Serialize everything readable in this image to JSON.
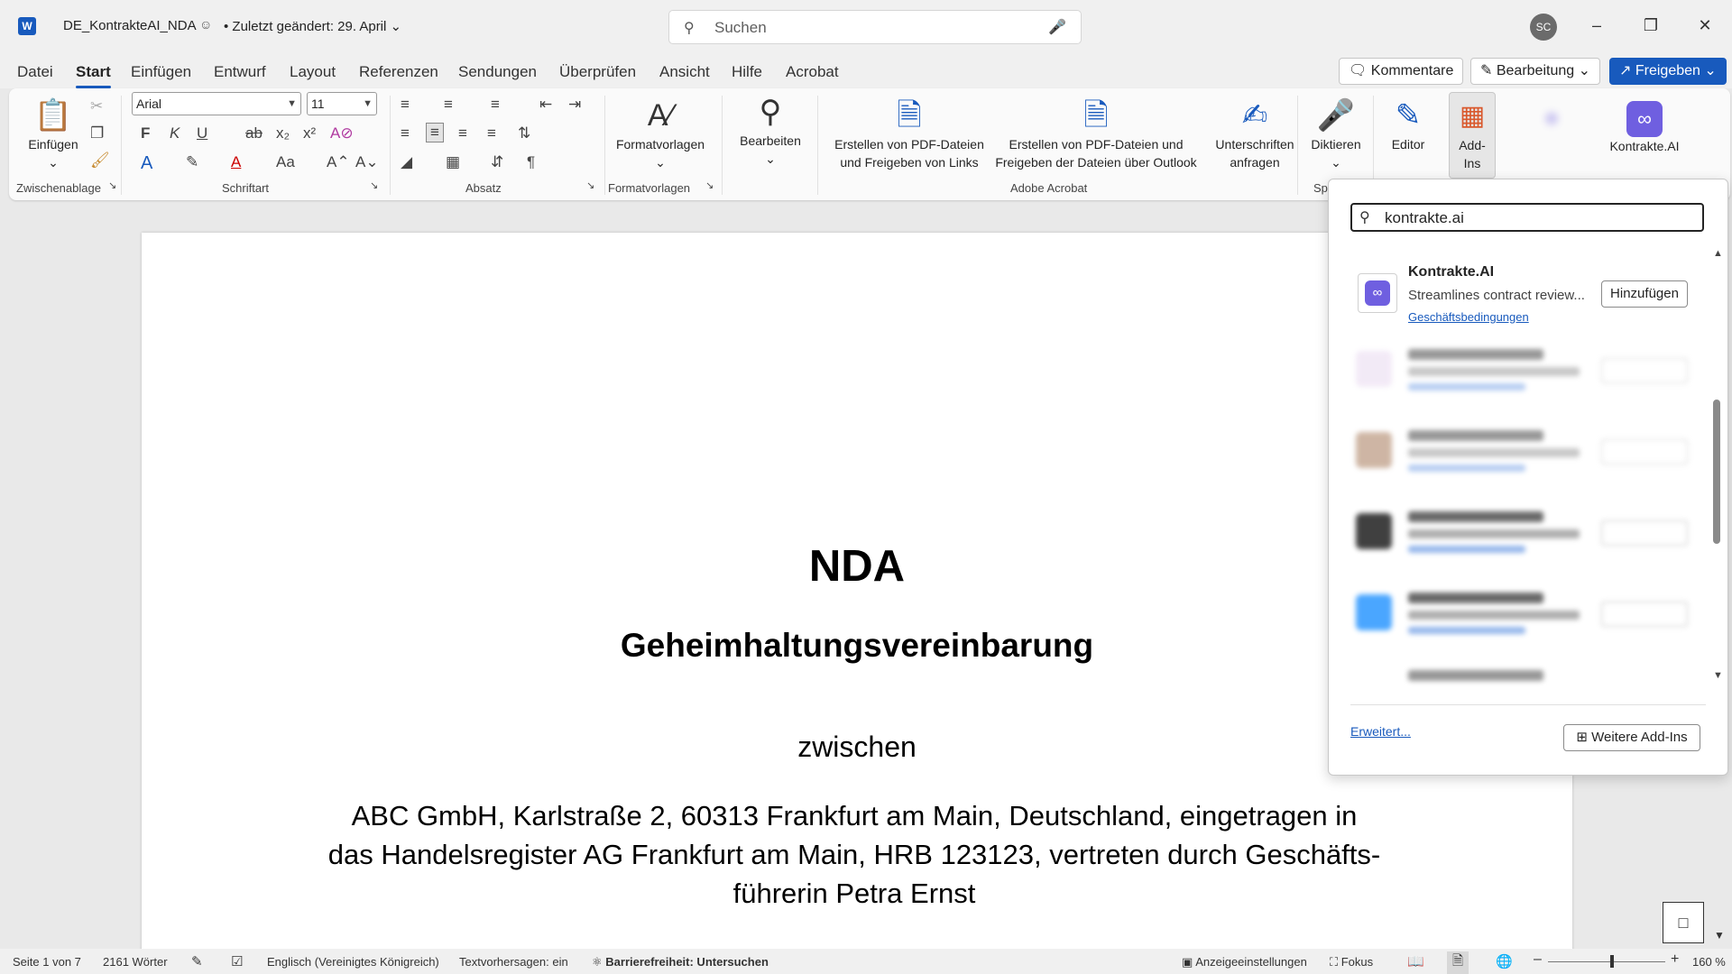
{
  "titlebar": {
    "app_icon": "word-icon",
    "app_letter": "W",
    "doc_name": "DE_KontrakteAI_NDA",
    "modified": "• Zuletzt geändert: 29. April",
    "search_placeholder": "Suchen",
    "avatar_initials": "SC"
  },
  "menu": {
    "tabs": [
      "Datei",
      "Start",
      "Einfügen",
      "Entwurf",
      "Layout",
      "Referenzen",
      "Sendungen",
      "Überprüfen",
      "Ansicht",
      "Hilfe",
      "Acrobat"
    ],
    "active": "Start",
    "comments": "Kommentare",
    "editing": "Bearbeitung",
    "share": "Freigeben"
  },
  "ribbon": {
    "paste": "Einfügen",
    "font_name": "Arial",
    "font_size": "11",
    "groups": {
      "clipboard": "Zwischenablage",
      "font": "Schriftart",
      "paragraph": "Absatz",
      "styles": "Formatvorlagen",
      "acrobat": "Adobe Acrobat",
      "voice": "Sp"
    },
    "styles_btn": "Formatvorlagen",
    "edit_btn": "Bearbeiten",
    "pdf_links_line1": "Erstellen von PDF-Dateien",
    "pdf_links_line2": "und Freigeben von Links",
    "pdf_outlook_line1": "Erstellen von PDF-Dateien und",
    "pdf_outlook_line2": "Freigeben der Dateien über Outlook",
    "signatures_line1": "Unterschriften",
    "signatures_line2": "anfragen",
    "dictate": "Diktieren",
    "editor": "Editor",
    "addins_line1": "Add-",
    "addins_line2": "Ins",
    "kontrakte": "Kontrakte.AI"
  },
  "document": {
    "title": "NDA",
    "subtitle": "Geheimhaltungsvereinbarung",
    "between": "zwischen",
    "party_line1": "ABC GmbH, Karlstraße 2, 60313 Frankfurt am Main, Deutschland, eingetragen in",
    "party_line2": "das Handelsregister AG Frankfurt am Main, HRB 123123, vertreten durch Geschäfts-",
    "party_line3": "führerin Petra Ernst"
  },
  "addins_panel": {
    "search_value": "kontrakte.ai",
    "result": {
      "name": "Kontrakte.AI",
      "description": "Streamlines contract review...",
      "terms_link": "Geschäftsbedingungen",
      "add_button": "Hinzufügen"
    },
    "advanced_link": "Erweitert...",
    "more_button": "Weitere Add-Ins"
  },
  "statusbar": {
    "page": "Seite 1 von 7",
    "words": "2161 Wörter",
    "language": "Englisch (Vereinigtes Königreich)",
    "predictions": "Textvorhersagen: ein",
    "accessibility": "Barrierefreiheit: Untersuchen",
    "display_settings": "Anzeigeeinstellungen",
    "focus": "Fokus",
    "zoom": "160 %"
  },
  "colors": {
    "accent": "#185abd",
    "addin_brand": "#6f5fe0"
  }
}
